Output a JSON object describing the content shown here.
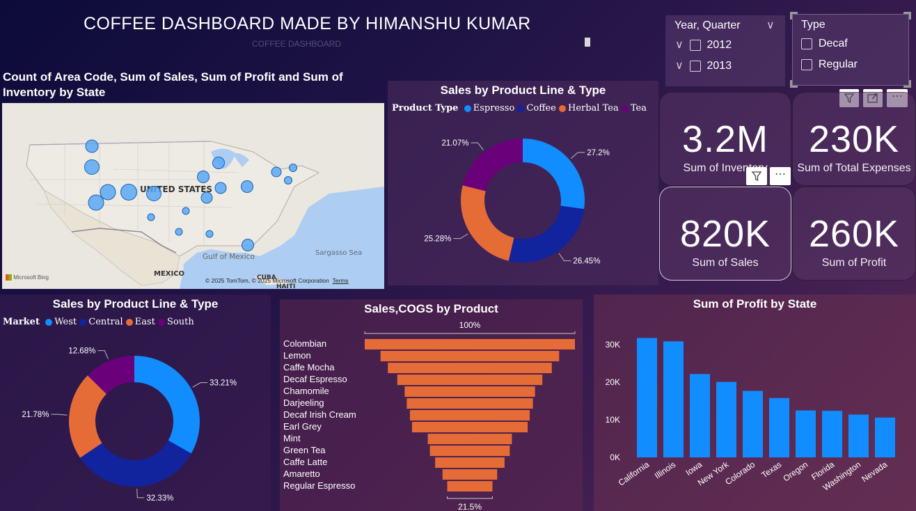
{
  "header": {
    "title": "COFFEE DASHBOARD MADE BY HIMANSHU KUMAR",
    "subtitle": "COFFEE DASHBOARD"
  },
  "slicers": {
    "year_quarter": {
      "title": "Year, Quarter",
      "options": [
        "2012",
        "2013"
      ]
    },
    "type": {
      "title": "Type",
      "options": [
        "Decaf",
        "Regular"
      ]
    }
  },
  "kpis": [
    {
      "value": "3.2M",
      "label": "Sum of Inventory"
    },
    {
      "value": "230K",
      "label": "Sum of Total Expenses"
    },
    {
      "value": "820K",
      "label": "Sum of Sales"
    },
    {
      "value": "260K",
      "label": "Sum of Profit"
    }
  ],
  "map": {
    "title": "Count of Area Code, Sum of Sales, Sum of Profit and Sum of Inventory by State",
    "labels": {
      "country": "UNITED STATES",
      "gulf": "Gulf of Mexico",
      "mexico": "MEXICO",
      "cuba": "CUBA",
      "haiti": "HAITI",
      "sargasso": "Sargasso Sea",
      "bing": "Microsoft Bing",
      "copyright": "© 2025 TomTom, © 2025 Microsoft Corporation",
      "terms": "Terms"
    }
  },
  "colors": {
    "espresso": "#118dff",
    "coffee": "#12239e",
    "herbal_tea": "#e66c37",
    "tea": "#6b007b",
    "funnel": "#e66c37",
    "bar": "#118dff",
    "map_bubble": "#5aa9f5"
  },
  "icons": [
    "filter-icon",
    "focus-mode-icon",
    "more-options-icon",
    "chevron-down-icon",
    "eraser-icon"
  ],
  "chart_data": [
    {
      "type": "pie",
      "title": "Sales by Product Line & Type",
      "legend_title": "Product Type",
      "legend_position": "top",
      "categories": [
        "Espresso",
        "Coffee",
        "Herbal Tea",
        "Tea"
      ],
      "values": [
        27.2,
        26.45,
        25.28,
        21.07
      ],
      "data_labels": [
        "27.2%",
        "26.45%",
        "25.28%",
        "21.07%"
      ]
    },
    {
      "type": "pie",
      "title": "Sales by Product Line & Type",
      "legend_title": "Market",
      "legend_position": "top",
      "categories": [
        "West",
        "Central",
        "East",
        "South"
      ],
      "values": [
        33.21,
        32.33,
        21.78,
        12.68
      ],
      "data_labels": [
        "33.21%",
        "32.33%",
        "21.78%",
        "12.68%"
      ]
    },
    {
      "type": "bar",
      "subtype": "funnel",
      "title": "Sales,COGS by Product",
      "top_label": "100%",
      "bottom_label": "21.5%",
      "categories": [
        "Colombian",
        "Lemon",
        "Caffe Mocha",
        "Decaf Espresso",
        "Chamomile",
        "Darjeeling",
        "Decaf Irish Cream",
        "Earl Grey",
        "Mint",
        "Green Tea",
        "Caffe Latte",
        "Amaretto",
        "Regular Espresso"
      ],
      "values": [
        100,
        85,
        78,
        69,
        62,
        60,
        57,
        55,
        40,
        38,
        33,
        26,
        21.5
      ]
    },
    {
      "type": "bar",
      "title": "Sum of Profit by State",
      "xlabel": "",
      "ylabel": "",
      "categories": [
        "California",
        "Illinois",
        "Iowa",
        "New York",
        "Colorado",
        "Texas",
        "Oregon",
        "Florida",
        "Washington",
        "Nevada"
      ],
      "values": [
        31800,
        30900,
        22200,
        20100,
        17700,
        15800,
        12500,
        12400,
        11400,
        10600
      ],
      "ylim": [
        0,
        33000
      ],
      "yticks": [
        0,
        10000,
        20000,
        30000
      ],
      "ytick_labels": [
        "0K",
        "10K",
        "20K",
        "30K"
      ],
      "grid": false
    }
  ]
}
